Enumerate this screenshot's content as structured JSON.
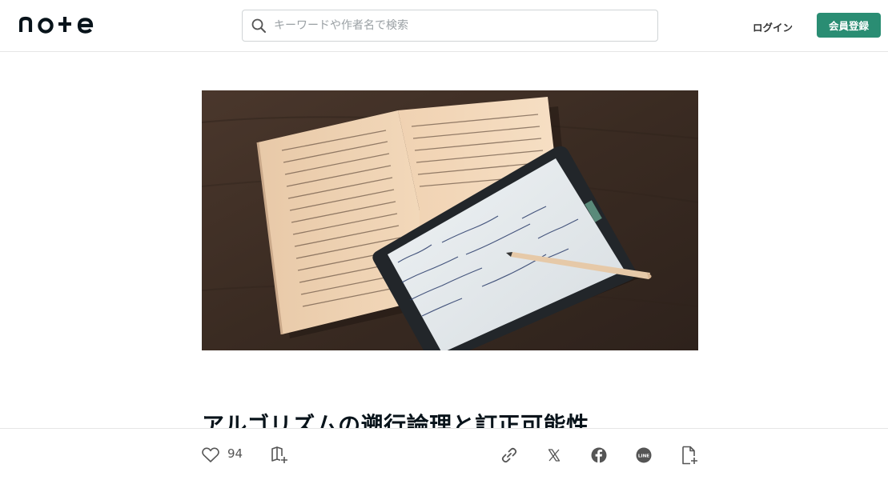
{
  "header": {
    "logo_text": "note",
    "search": {
      "placeholder": "キーワードや作者名で検索",
      "value": "",
      "icon": "search-icon"
    },
    "login_label": "ログイン",
    "signup_label": "会員登録",
    "signup_color": "#2a8d73"
  },
  "article": {
    "title": "アルゴリズムの遡行論理と訂正可能性",
    "hero_image": "open book and tablet with handwritten math on wooden desk"
  },
  "actions": {
    "like_icon": "heart-icon",
    "like_count": "94",
    "magazine_icon": "magazine-add-icon",
    "share_icons": [
      "link-icon",
      "x-icon",
      "facebook-icon",
      "line-icon",
      "note-add-icon"
    ],
    "line_label": "LINE"
  }
}
